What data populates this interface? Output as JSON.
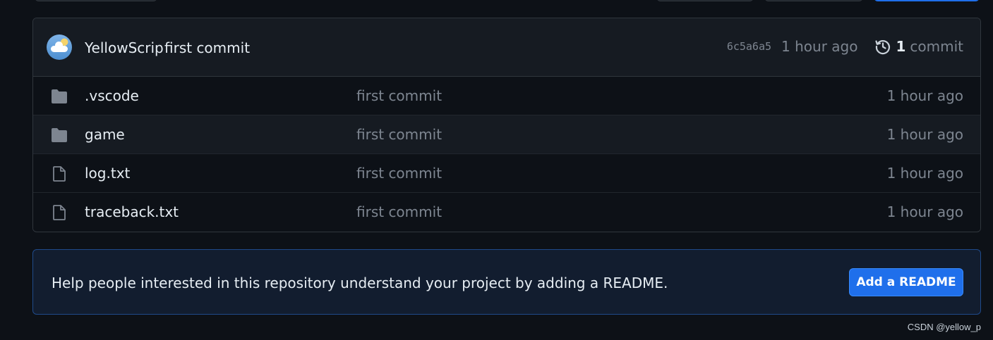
{
  "latest_commit": {
    "author": "YellowScrip",
    "message": "first commit",
    "sha": "6c5a6a5",
    "time": "1 hour ago",
    "commit_count": "1",
    "commit_label": "commit"
  },
  "files": [
    {
      "name": ".vscode",
      "type": "folder",
      "message": "first commit",
      "time": "1 hour ago"
    },
    {
      "name": "game",
      "type": "folder",
      "message": "first commit",
      "time": "1 hour ago"
    },
    {
      "name": "log.txt",
      "type": "file",
      "message": "first commit",
      "time": "1 hour ago"
    },
    {
      "name": "traceback.txt",
      "type": "file",
      "message": "first commit",
      "time": "1 hour ago"
    }
  ],
  "readme_banner": {
    "text": "Help people interested in this repository understand your project by adding a README.",
    "button_label": "Add a README"
  },
  "watermark": "CSDN @yellow_p",
  "colors": {
    "background": "#0d1117",
    "primary_button": "#1f6feb",
    "muted_text": "#7d8590"
  },
  "icons": {
    "folder": "folder-icon",
    "file": "file-icon",
    "history": "history-icon",
    "avatar": "avatar-icon"
  }
}
